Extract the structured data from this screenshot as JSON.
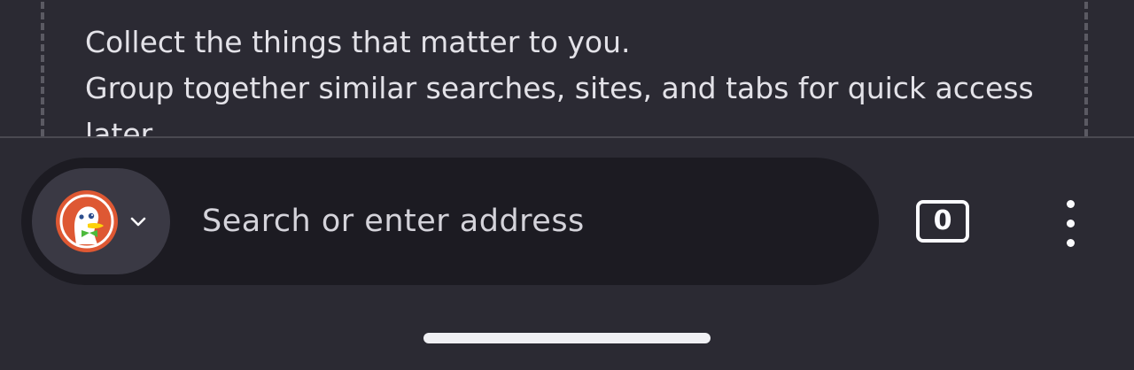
{
  "collections_promo": {
    "line1": "Collect the things that matter to you.",
    "line2": "Group together similar searches, sites, and tabs for quick access",
    "line3": "later."
  },
  "toolbar": {
    "search_engine": {
      "icon": "duckduckgo-logo-icon",
      "dropdown_icon": "chevron-down-icon"
    },
    "address_bar": {
      "placeholder": "Search or enter address",
      "value": ""
    },
    "tab_counter": {
      "count": "0"
    },
    "menu_icon": "three-dot-menu-icon"
  },
  "colors": {
    "background": "#2b2a33",
    "urlbar": "#1c1b22",
    "engine_button": "#3a3944",
    "text": "#e3e2e8",
    "duckduckgo_orange": "#de5833"
  }
}
